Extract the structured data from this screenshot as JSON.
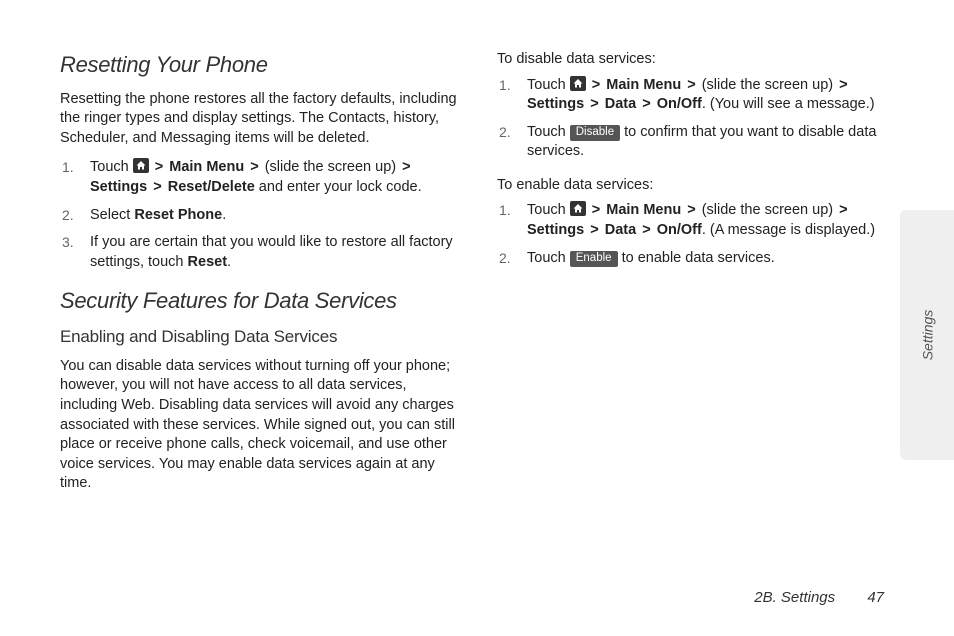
{
  "left": {
    "h1": "Resetting Your Phone",
    "intro": "Resetting the phone restores all the factory defaults, including the ringer types and display settings. The Contacts, history, Scheduler, and Messaging items will be deleted.",
    "steps": {
      "s1_pre": "Touch ",
      "s1_mainmenu": "Main Menu",
      "s1_slide": " (slide the screen up) ",
      "s1_settings": "Settings",
      "s1_reset": "Reset/Delete",
      "s1_post": " and enter your lock code.",
      "s2_pre": "Select ",
      "s2_bold": "Reset Phone",
      "s2_post": ".",
      "s3_pre": "If you are certain that you would like to restore all factory settings, touch ",
      "s3_bold": "Reset",
      "s3_post": "."
    },
    "h2": "Security Features for Data Services",
    "h3": "Enabling and Disabling Data Services",
    "body2": "You can disable data services without turning off your phone; however, you will not have access to all data services, including Web. Disabling data services will avoid any charges associated with these services. While signed out, you can still place or receive phone calls, check voicemail, and use other voice services. You may enable data services again at any time."
  },
  "right": {
    "lead_disable": "To disable data services:",
    "d1_pre": "Touch ",
    "d1_mainmenu": "Main Menu",
    "d1_slide": " (slide the screen up) ",
    "d1_settings": "Settings",
    "d1_data": "Data",
    "d1_onoff": "On/Off",
    "d1_post": ". (You will see a message.)",
    "d2_pre": "Touch ",
    "d2_btn": "Disable",
    "d2_post": " to confirm that you want to disable data services.",
    "lead_enable": "To enable data services:",
    "e1_pre": "Touch ",
    "e1_mainmenu": "Main Menu",
    "e1_slide": " (slide the screen up) ",
    "e1_settings": "Settings",
    "e1_data": "Data",
    "e1_onoff": "On/Off",
    "e1_post": ". (A message is displayed.)",
    "e2_pre": "Touch ",
    "e2_btn": "Enable",
    "e2_post": " to enable data services."
  },
  "sidetab": "Settings",
  "footer_section": "2B. Settings",
  "footer_page": "47",
  "gt": ">"
}
